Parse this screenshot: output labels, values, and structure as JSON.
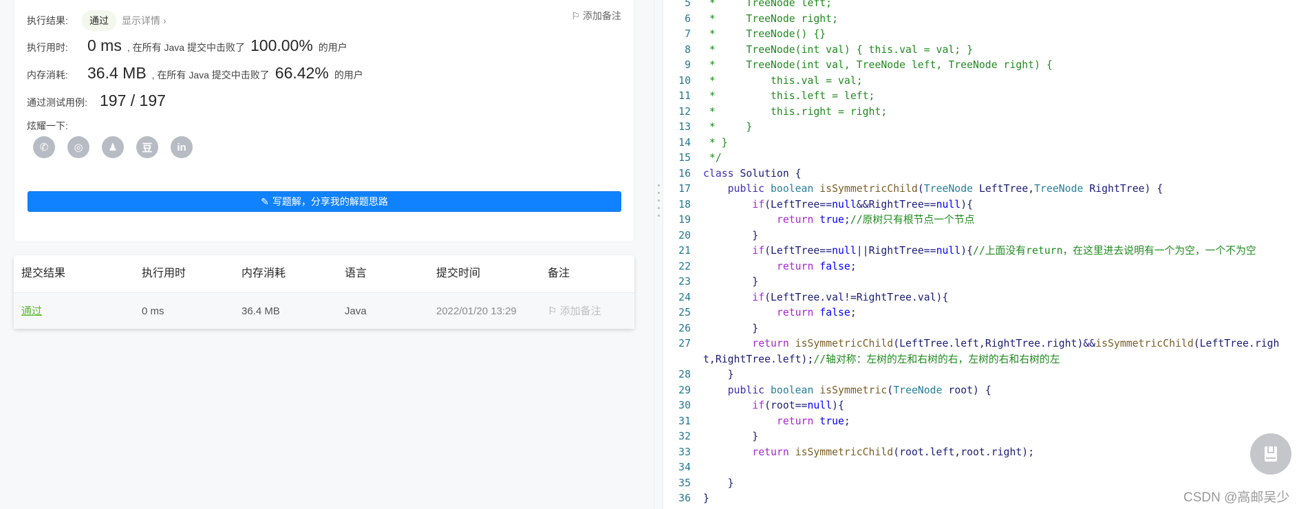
{
  "result": {
    "exec_result_label": "执行结果:",
    "exec_result_value": "通过",
    "show_details": "显示详情 ›",
    "add_note": "添加备注",
    "time_label": "执行用时:",
    "time_value": "0 ms",
    "beat_text": ", 在所有 Java 提交中击败了",
    "time_percent": "100.00%",
    "users": "的用户",
    "mem_label": "内存消耗:",
    "mem_value": "36.4 MB",
    "mem_percent": "66.42%",
    "tests_label": "通过测试用例:",
    "tests_value": "197 / 197",
    "share_label": "炫耀一下:",
    "share_icons": [
      "wechat-icon",
      "weibo-icon",
      "qq-icon",
      "douban-icon",
      "linkedin-icon"
    ],
    "share_glyphs": [
      "✆",
      "◎",
      "♟",
      "豆",
      "in"
    ],
    "write_solution": "写题解，分享我的解题思路"
  },
  "table": {
    "headers": [
      "提交结果",
      "执行用时",
      "内存消耗",
      "语言",
      "提交时间",
      "备注"
    ],
    "row": {
      "status": "通过",
      "time": "0 ms",
      "memory": "36.4 MB",
      "language": "Java",
      "submitted": "2022/01/20 13:29",
      "note": "添加备注"
    }
  },
  "code": [
    {
      "n": "5",
      "t": " *     TreeNode left;"
    },
    {
      "n": "6",
      "t": " *     TreeNode right;"
    },
    {
      "n": "7",
      "t": " *     TreeNode() {}"
    },
    {
      "n": "8",
      "t": " *     TreeNode(int val) { this.val = val; }"
    },
    {
      "n": "9",
      "t": " *     TreeNode(int val, TreeNode left, TreeNode right) {"
    },
    {
      "n": "10",
      "t": " *         this.val = val;"
    },
    {
      "n": "11",
      "t": " *         this.left = left;"
    },
    {
      "n": "12",
      "t": " *         this.right = right;"
    },
    {
      "n": "13",
      "t": " *     }"
    },
    {
      "n": "14",
      "t": " * }"
    },
    {
      "n": "15",
      "t": " */"
    },
    {
      "n": "16",
      "t": "class Solution {"
    },
    {
      "n": "17",
      "t": "    public boolean isSymmetricChild(TreeNode LeftTree,TreeNode RightTree) {"
    },
    {
      "n": "18",
      "t": "        if(LeftTree==null&&RightTree==null){"
    },
    {
      "n": "19",
      "t": "            return true;//原树只有根节点一个节点"
    },
    {
      "n": "20",
      "t": "        }"
    },
    {
      "n": "21",
      "t": "        if(LeftTree==null||RightTree==null){//上面没有return，在这里进去说明有一个为空，一个不为空"
    },
    {
      "n": "22",
      "t": "            return false;"
    },
    {
      "n": "23",
      "t": "        }"
    },
    {
      "n": "24",
      "t": "        if(LeftTree.val!=RightTree.val){"
    },
    {
      "n": "25",
      "t": "            return false;"
    },
    {
      "n": "26",
      "t": "        }"
    },
    {
      "n": "27",
      "t": "        return isSymmetricChild(LeftTree.left,RightTree.right)&&isSymmetricChild(LeftTree.right,RightTree.left);//轴对称：左树的左和右树的右，左树的右和右树的左"
    },
    {
      "n": "28",
      "t": "    }"
    },
    {
      "n": "29",
      "t": "    public boolean isSymmetric(TreeNode root) {"
    },
    {
      "n": "30",
      "t": "        if(root==null){"
    },
    {
      "n": "31",
      "t": "            return true;"
    },
    {
      "n": "32",
      "t": "        }"
    },
    {
      "n": "33",
      "t": "        return isSymmetricChild(root.left,root.right);"
    },
    {
      "n": "34",
      "t": ""
    },
    {
      "n": "35",
      "t": "    }"
    },
    {
      "n": "36",
      "t": "}"
    }
  ],
  "watermark": "CSDN @高邮吴少",
  "colors": {
    "accent": "#1082ff",
    "success": "#5cb82f"
  }
}
